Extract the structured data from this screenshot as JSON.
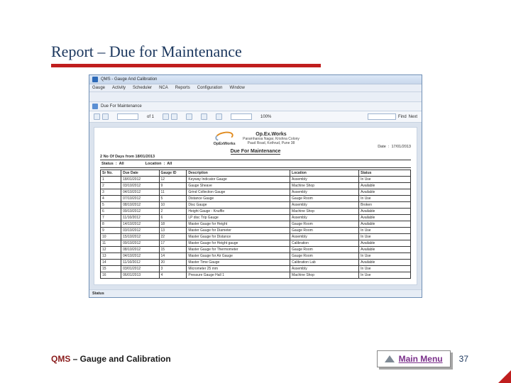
{
  "slide": {
    "title": "Report – Due for Maintenance"
  },
  "app": {
    "title": "QMS - Gauge And Calibration",
    "menubar": [
      "Gauge",
      "Activity",
      "Scheduler",
      "NCA",
      "Reports",
      "Configuration",
      "Window"
    ],
    "doc_tab": "Due For Maintenance",
    "page_indicator": "of 1",
    "zoom": "100%",
    "find_label": "Find",
    "next_label": "Next"
  },
  "report": {
    "brand": "OpExWorks",
    "company": "Op.Ex.Works",
    "addr1": "Paramhansa Nagar, Krishna Colony",
    "addr2": "Paud Road, Kothrud, Pune 38",
    "heading": "Due For Maintenance",
    "date_label": "Date",
    "date_value": "17/01/2013",
    "range_line": "2 No Of Days from 18/01/2013",
    "status_label": "Status",
    "status_value": "All",
    "location_label": "Location",
    "location_value": "All",
    "columns": [
      "Sr No.",
      "Due Date",
      "Gauge ID",
      "Description",
      "Location",
      "Status"
    ],
    "rows": [
      {
        "sr": "1",
        "date": "18/01/2012",
        "id": "12",
        "desc": "Keyway Indicator Gauge",
        "loc": "Assembly",
        "stat": "In Use"
      },
      {
        "sr": "2",
        "date": "03/10/2012",
        "id": "9",
        "desc": "Gauge Sheave",
        "loc": "Machine Shop",
        "stat": "Available"
      },
      {
        "sr": "3",
        "date": "04/10/2012",
        "id": "11",
        "desc": "Grind Collection Gauge",
        "loc": "Assembly",
        "stat": "Available"
      },
      {
        "sr": "4",
        "date": "07/10/2012",
        "id": "5",
        "desc": "Distance Gauge",
        "loc": "Gauge Room",
        "stat": "In Use"
      },
      {
        "sr": "5",
        "date": "08/10/2012",
        "id": "10",
        "desc": "Disc Gauge",
        "loc": "Assembly",
        "stat": "Broken"
      },
      {
        "sr": "6",
        "date": "09/10/2012",
        "id": "2",
        "desc": "Height Gauge - Knuffle",
        "loc": "Machine Shop",
        "stat": "Available"
      },
      {
        "sr": "7",
        "date": "11/10/2012",
        "id": "6",
        "desc": "LP disc Trip Gauge",
        "loc": "Assembly",
        "stat": "Available"
      },
      {
        "sr": "8",
        "date": "14/10/2012",
        "id": "18",
        "desc": "Master Gauge for Height",
        "loc": "Gauge Room",
        "stat": "Available"
      },
      {
        "sr": "9",
        "date": "03/10/2012",
        "id": "13",
        "desc": "Master Gauge for Diameter",
        "loc": "Gauge Room",
        "stat": "In Use"
      },
      {
        "sr": "10",
        "date": "15/10/2012",
        "id": "22",
        "desc": "Master Gauge for Distance",
        "loc": "Assembly",
        "stat": "In Use"
      },
      {
        "sr": "11",
        "date": "09/10/2012",
        "id": "17",
        "desc": "Master Gauge for Height gauge",
        "loc": "Calibration",
        "stat": "Available"
      },
      {
        "sr": "12",
        "date": "08/10/2012",
        "id": "15",
        "desc": "Master Gauge for Thermometer",
        "loc": "Gauge Room",
        "stat": "Available"
      },
      {
        "sr": "13",
        "date": "04/10/2012",
        "id": "14",
        "desc": "Master Gauge for Air Gauge",
        "loc": "Gauge Room",
        "stat": "In Use"
      },
      {
        "sr": "14",
        "date": "11/10/2012",
        "id": "20",
        "desc": "Master Time Gauge",
        "loc": "Calibration Lab",
        "stat": "Available"
      },
      {
        "sr": "15",
        "date": "03/01/2012",
        "id": "3",
        "desc": "Micrometer 25 mm",
        "loc": "Assembly",
        "stat": "In Use"
      },
      {
        "sr": "16",
        "date": "06/01/2013",
        "id": "4",
        "desc": "Pressure Gauge Hall 1",
        "loc": "Machine Shop",
        "stat": "In Use"
      }
    ]
  },
  "statusbar": "Status",
  "footer": {
    "qms": "QMS",
    "label": " – Gauge and Calibration",
    "main_menu": "Main Menu",
    "page": "37"
  }
}
